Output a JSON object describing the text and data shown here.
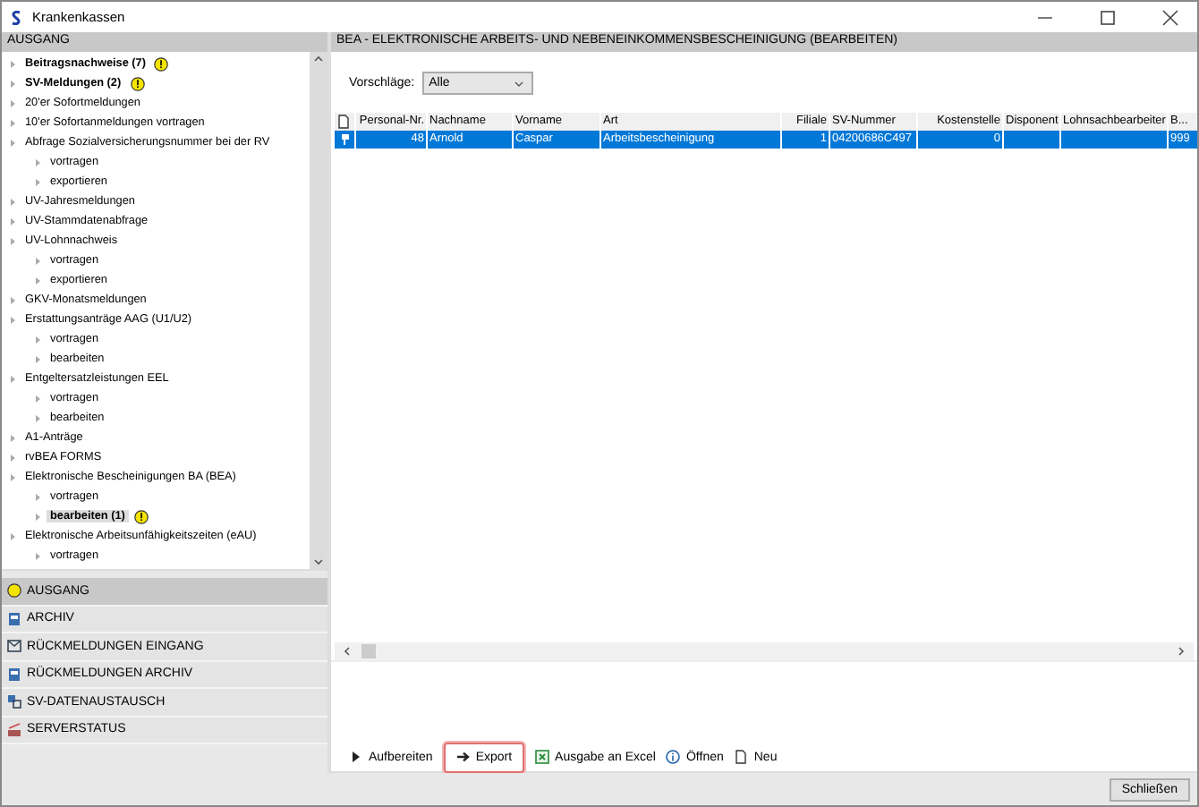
{
  "window": {
    "title": "Krankenkassen"
  },
  "sidebar": {
    "header": "AUSGANG",
    "tree": [
      {
        "label": "Beitragsnachweise (7)",
        "bold": true,
        "warning": true,
        "selected": false
      },
      {
        "label": "SV-Meldungen (2)",
        "bold": true,
        "warning": true,
        "selected": false
      },
      {
        "label": "20'er Sofortmeldungen",
        "bold": false,
        "warning": false,
        "selected": false
      },
      {
        "label": "10'er Sofortanmeldungen vortragen",
        "bold": false,
        "warning": false,
        "selected": false
      },
      {
        "label": "Abfrage Sozialversicherungsnummer bei der RV",
        "bold": false,
        "warning": false,
        "selected": false,
        "children": [
          {
            "label": "vortragen",
            "bold": false,
            "warning": false,
            "selected": false
          },
          {
            "label": "exportieren",
            "bold": false,
            "warning": false,
            "selected": false
          }
        ]
      },
      {
        "label": "UV-Jahresmeldungen",
        "bold": false,
        "warning": false,
        "selected": false
      },
      {
        "label": "UV-Stammdatenabfrage",
        "bold": false,
        "warning": false,
        "selected": false
      },
      {
        "label": "UV-Lohnnachweis",
        "bold": false,
        "warning": false,
        "selected": false,
        "children": [
          {
            "label": "vortragen",
            "bold": false,
            "warning": false,
            "selected": false
          },
          {
            "label": "exportieren",
            "bold": false,
            "warning": false,
            "selected": false
          }
        ]
      },
      {
        "label": "GKV-Monatsmeldungen",
        "bold": false,
        "warning": false,
        "selected": false
      },
      {
        "label": "Erstattungsanträge AAG (U1/U2)",
        "bold": false,
        "warning": false,
        "selected": false,
        "children": [
          {
            "label": "vortragen",
            "bold": false,
            "warning": false,
            "selected": false
          },
          {
            "label": "bearbeiten",
            "bold": false,
            "warning": false,
            "selected": false
          }
        ]
      },
      {
        "label": "Entgeltersatzleistungen EEL",
        "bold": false,
        "warning": false,
        "selected": false,
        "children": [
          {
            "label": "vortragen",
            "bold": false,
            "warning": false,
            "selected": false
          },
          {
            "label": "bearbeiten",
            "bold": false,
            "warning": false,
            "selected": false
          }
        ]
      },
      {
        "label": "A1-Anträge",
        "bold": false,
        "warning": false,
        "selected": false
      },
      {
        "label": "rvBEA FORMS",
        "bold": false,
        "warning": false,
        "selected": false
      },
      {
        "label": "Elektronische Bescheinigungen BA (BEA)",
        "bold": false,
        "warning": false,
        "selected": false,
        "children": [
          {
            "label": "vortragen",
            "bold": false,
            "warning": false,
            "selected": false
          },
          {
            "label": "bearbeiten (1)",
            "bold": true,
            "warning": true,
            "selected": true
          }
        ]
      },
      {
        "label": "Elektronische Arbeitsunfähigkeitszeiten (eAU)",
        "bold": false,
        "warning": false,
        "selected": false,
        "children": [
          {
            "label": "vortragen",
            "bold": false,
            "warning": false,
            "selected": false
          }
        ]
      }
    ],
    "nav": [
      {
        "label": "AUSGANG",
        "kind": "warning",
        "selected": true
      },
      {
        "label": "ARCHIV",
        "kind": "archive",
        "selected": false
      },
      {
        "label": "RÜCKMELDUNGEN EINGANG",
        "kind": "inbox",
        "selected": false
      },
      {
        "label": "RÜCKMELDUNGEN ARCHIV",
        "kind": "archive",
        "selected": false
      },
      {
        "label": "SV-DATENAUSTAUSCH",
        "kind": "exchange",
        "selected": false
      },
      {
        "label": "SERVERSTATUS",
        "kind": "server",
        "selected": false
      }
    ]
  },
  "content": {
    "header": "BEA - ELEKTRONISCHE ARBEITS- UND NEBENEINKOMMENSBESCHEINIGUNG (BEARBEITEN)",
    "filter": {
      "label": "Vorschläge:",
      "value": "Alle"
    },
    "table": {
      "columns": [
        {
          "label": "Personal-Nr."
        },
        {
          "label": "Nachname"
        },
        {
          "label": "Vorname"
        },
        {
          "label": "Art"
        },
        {
          "label": "Filiale"
        },
        {
          "label": "SV-Nummer"
        },
        {
          "label": "Kostenstelle"
        },
        {
          "label": "Disponent"
        },
        {
          "label": "Lohnsachbearbeiter"
        },
        {
          "label": "B..."
        }
      ],
      "rows": [
        {
          "selected": true,
          "cells": [
            "48",
            "Arnold",
            "Caspar",
            "Arbeitsbescheinigung",
            "1",
            "04200686C497",
            "0",
            "",
            "",
            "999"
          ]
        }
      ]
    },
    "toolbar": [
      {
        "label": "Aufbereiten",
        "kind": "play",
        "focused": false
      },
      {
        "label": "Export",
        "kind": "arrow",
        "focused": true
      },
      {
        "label": "Ausgabe an Excel",
        "kind": "excel",
        "focused": false
      },
      {
        "label": "Öffnen",
        "kind": "info",
        "focused": false
      },
      {
        "label": "Neu",
        "kind": "doc",
        "focused": false
      }
    ]
  },
  "footer": {
    "button": "Schließen"
  }
}
